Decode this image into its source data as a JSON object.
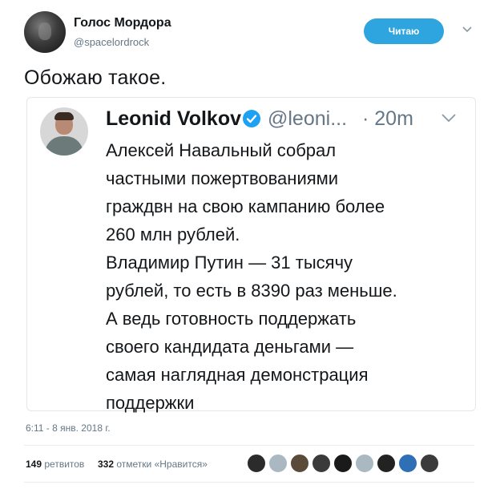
{
  "author": {
    "name": "Голос Мордора",
    "handle": "@spacelordrock"
  },
  "follow_button": {
    "label": "Читаю"
  },
  "tweet": {
    "text": "Обожаю такое."
  },
  "quoted_tweet": {
    "author_name": "Leonid Volkov",
    "handle": "@leoni...",
    "time": "· 20m",
    "lines": [
      "Алексей Навальный собрал",
      "частными пожертвованиями",
      "граждвн на свою кампанию более",
      "260 млн рублей.",
      "Владимир Путин — 31 тысячу",
      "рублей, то есть в 8390 раз меньше.",
      "А ведь готовность поддержать",
      "своего кандидата деньгами —",
      "самая наглядная демонстрация",
      "поддержки"
    ]
  },
  "date": "6:11 - 8 янв. 2018 г.",
  "stats": {
    "retweets_count": "149",
    "retweets_label": "ретвитов",
    "likes_count": "332",
    "likes_label": "отметки «Нравится»"
  },
  "likers": [
    {
      "icon": "avatar-icon",
      "color": "#2b2b2b"
    },
    {
      "icon": "default-avatar-icon",
      "color": "#aab8c2"
    },
    {
      "icon": "avatar-icon",
      "color": "#5a4a3a"
    },
    {
      "icon": "avatar-icon",
      "color": "#3a3a3a"
    },
    {
      "icon": "avatar-icon",
      "color": "#1a1a1a"
    },
    {
      "icon": "default-avatar-icon",
      "color": "#aab8c2"
    },
    {
      "icon": "avatar-icon",
      "color": "#222222"
    },
    {
      "icon": "avatar-icon",
      "color": "#2e6fb5"
    },
    {
      "icon": "avatar-icon",
      "color": "#3b3b3b"
    }
  ],
  "colors": {
    "accent": "#2fa5df",
    "muted": "#657786",
    "verified": "#1da1f2"
  }
}
